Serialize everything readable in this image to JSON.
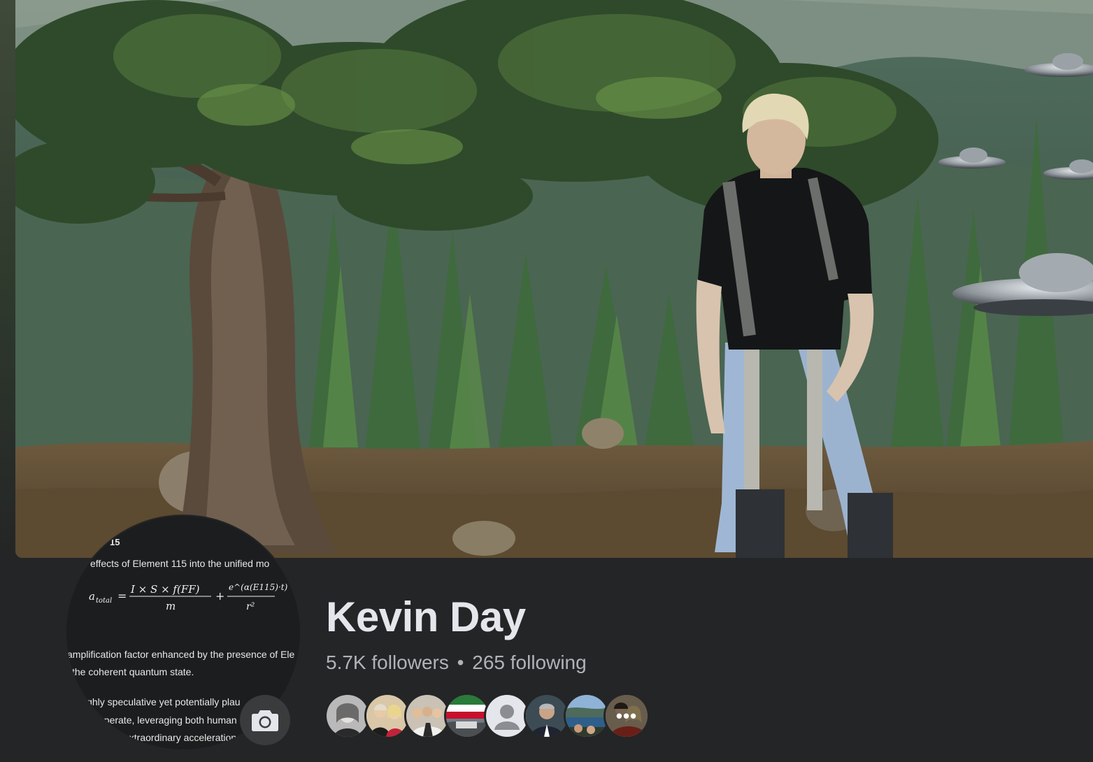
{
  "profile": {
    "name": "Kevin Day",
    "followers": "5.7K followers",
    "separator": "•",
    "following": "265 following"
  },
  "avatar": {
    "text_top": "15",
    "text_line1": "effects of Element 115 into the unified mo",
    "text_line2": "amplification factor enhanced by the presence of Ele",
    "text_line3": "the coherent quantum state.",
    "text_line4": "ighly speculative yet potentially plau",
    "text_line5": "operate, leveraging both human",
    "text_line6": "extraordinary acceleration",
    "equation_lhs": "a",
    "equation_sub": "total",
    "equation_num1": "I × S × f(FF)",
    "equation_den1": "m",
    "equation_num2": "e^(α(E115)·t)",
    "equation_den2": "r²"
  },
  "camera_button": {
    "icon": "camera-icon"
  },
  "friends_more": "•••",
  "colors": {
    "background": "#242526",
    "name": "#e4e6eb",
    "secondary_text": "#b0b3b8",
    "camera_button": "#3a3b3c"
  }
}
